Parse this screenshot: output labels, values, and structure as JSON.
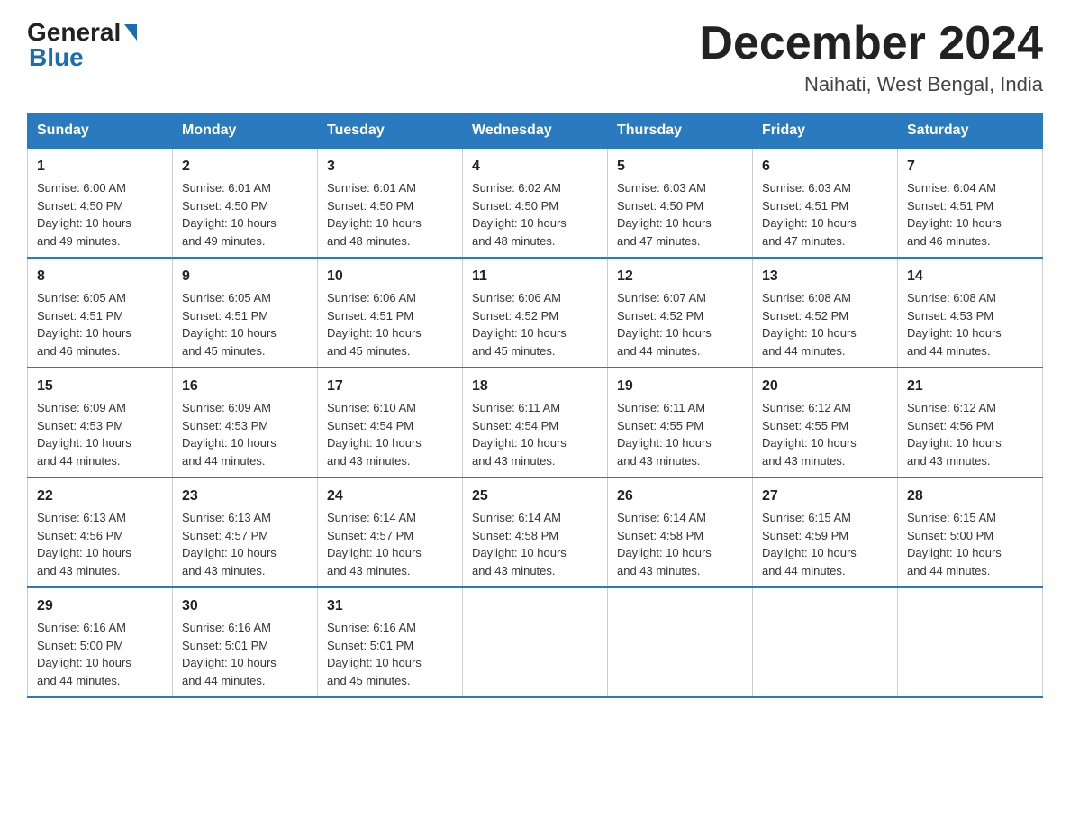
{
  "logo": {
    "text1": "General",
    "text2": "Blue"
  },
  "title": "December 2024",
  "location": "Naihati, West Bengal, India",
  "days_of_week": [
    "Sunday",
    "Monday",
    "Tuesday",
    "Wednesday",
    "Thursday",
    "Friday",
    "Saturday"
  ],
  "weeks": [
    [
      {
        "day": "1",
        "sunrise": "6:00 AM",
        "sunset": "4:50 PM",
        "daylight": "10 hours and 49 minutes."
      },
      {
        "day": "2",
        "sunrise": "6:01 AM",
        "sunset": "4:50 PM",
        "daylight": "10 hours and 49 minutes."
      },
      {
        "day": "3",
        "sunrise": "6:01 AM",
        "sunset": "4:50 PM",
        "daylight": "10 hours and 48 minutes."
      },
      {
        "day": "4",
        "sunrise": "6:02 AM",
        "sunset": "4:50 PM",
        "daylight": "10 hours and 48 minutes."
      },
      {
        "day": "5",
        "sunrise": "6:03 AM",
        "sunset": "4:50 PM",
        "daylight": "10 hours and 47 minutes."
      },
      {
        "day": "6",
        "sunrise": "6:03 AM",
        "sunset": "4:51 PM",
        "daylight": "10 hours and 47 minutes."
      },
      {
        "day": "7",
        "sunrise": "6:04 AM",
        "sunset": "4:51 PM",
        "daylight": "10 hours and 46 minutes."
      }
    ],
    [
      {
        "day": "8",
        "sunrise": "6:05 AM",
        "sunset": "4:51 PM",
        "daylight": "10 hours and 46 minutes."
      },
      {
        "day": "9",
        "sunrise": "6:05 AM",
        "sunset": "4:51 PM",
        "daylight": "10 hours and 45 minutes."
      },
      {
        "day": "10",
        "sunrise": "6:06 AM",
        "sunset": "4:51 PM",
        "daylight": "10 hours and 45 minutes."
      },
      {
        "day": "11",
        "sunrise": "6:06 AM",
        "sunset": "4:52 PM",
        "daylight": "10 hours and 45 minutes."
      },
      {
        "day": "12",
        "sunrise": "6:07 AM",
        "sunset": "4:52 PM",
        "daylight": "10 hours and 44 minutes."
      },
      {
        "day": "13",
        "sunrise": "6:08 AM",
        "sunset": "4:52 PM",
        "daylight": "10 hours and 44 minutes."
      },
      {
        "day": "14",
        "sunrise": "6:08 AM",
        "sunset": "4:53 PM",
        "daylight": "10 hours and 44 minutes."
      }
    ],
    [
      {
        "day": "15",
        "sunrise": "6:09 AM",
        "sunset": "4:53 PM",
        "daylight": "10 hours and 44 minutes."
      },
      {
        "day": "16",
        "sunrise": "6:09 AM",
        "sunset": "4:53 PM",
        "daylight": "10 hours and 44 minutes."
      },
      {
        "day": "17",
        "sunrise": "6:10 AM",
        "sunset": "4:54 PM",
        "daylight": "10 hours and 43 minutes."
      },
      {
        "day": "18",
        "sunrise": "6:11 AM",
        "sunset": "4:54 PM",
        "daylight": "10 hours and 43 minutes."
      },
      {
        "day": "19",
        "sunrise": "6:11 AM",
        "sunset": "4:55 PM",
        "daylight": "10 hours and 43 minutes."
      },
      {
        "day": "20",
        "sunrise": "6:12 AM",
        "sunset": "4:55 PM",
        "daylight": "10 hours and 43 minutes."
      },
      {
        "day": "21",
        "sunrise": "6:12 AM",
        "sunset": "4:56 PM",
        "daylight": "10 hours and 43 minutes."
      }
    ],
    [
      {
        "day": "22",
        "sunrise": "6:13 AM",
        "sunset": "4:56 PM",
        "daylight": "10 hours and 43 minutes."
      },
      {
        "day": "23",
        "sunrise": "6:13 AM",
        "sunset": "4:57 PM",
        "daylight": "10 hours and 43 minutes."
      },
      {
        "day": "24",
        "sunrise": "6:14 AM",
        "sunset": "4:57 PM",
        "daylight": "10 hours and 43 minutes."
      },
      {
        "day": "25",
        "sunrise": "6:14 AM",
        "sunset": "4:58 PM",
        "daylight": "10 hours and 43 minutes."
      },
      {
        "day": "26",
        "sunrise": "6:14 AM",
        "sunset": "4:58 PM",
        "daylight": "10 hours and 43 minutes."
      },
      {
        "day": "27",
        "sunrise": "6:15 AM",
        "sunset": "4:59 PM",
        "daylight": "10 hours and 44 minutes."
      },
      {
        "day": "28",
        "sunrise": "6:15 AM",
        "sunset": "5:00 PM",
        "daylight": "10 hours and 44 minutes."
      }
    ],
    [
      {
        "day": "29",
        "sunrise": "6:16 AM",
        "sunset": "5:00 PM",
        "daylight": "10 hours and 44 minutes."
      },
      {
        "day": "30",
        "sunrise": "6:16 AM",
        "sunset": "5:01 PM",
        "daylight": "10 hours and 44 minutes."
      },
      {
        "day": "31",
        "sunrise": "6:16 AM",
        "sunset": "5:01 PM",
        "daylight": "10 hours and 45 minutes."
      },
      null,
      null,
      null,
      null
    ]
  ],
  "labels": {
    "sunrise": "Sunrise:",
    "sunset": "Sunset:",
    "daylight": "Daylight:"
  }
}
